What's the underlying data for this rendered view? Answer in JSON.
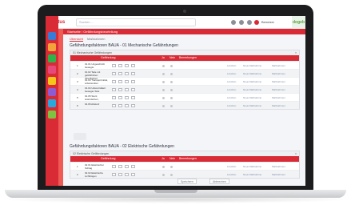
{
  "app": {
    "logo": "Meritus",
    "corner_logo": "dogeb",
    "search_placeholder": "Suchen ...",
    "user": "Benutzer"
  },
  "breadcrumb": "Startseite / Gefährdungsbeurteilung",
  "tabs": [
    {
      "label": "Übersicht",
      "active": true
    },
    {
      "label": "Maßnahmen",
      "active": false
    }
  ],
  "sections": [
    {
      "title": "Gefährdungsfaktoren BAUA - 01 Mechanische Gefährdungen",
      "panel_label": "01 Mechanische Gefährdungen",
      "columns": [
        "Gefährdung",
        "Ja",
        "Nein",
        "Bemerkungen"
      ],
      "rows": [
        {
          "num": "1",
          "text": "01.01 Ungeschützt bewegte Maschinenteile"
        },
        {
          "num": "2",
          "text": "01.02 Teile mit gefährlichen Oberflächen"
        },
        {
          "num": "3",
          "text": "01.03 Transportmittel, Arbeitsmittel"
        },
        {
          "num": "4",
          "text": "01.04 Unkontrolliert bewegte Teile"
        },
        {
          "num": "5",
          "text": "01.05 Sturz, Ausrutschen, Stolpern, Umknicken"
        },
        {
          "num": "6",
          "text": "01.06 Absturz"
        }
      ],
      "actions": [
        "Löschen",
        "Neue Maßnahme",
        "Maßnahmen"
      ]
    },
    {
      "title": "Gefährdungsfaktoren BAUA - 02 Elektrische Gefährdungen",
      "panel_label": "02 Elektrische Gefährdungen",
      "columns": [
        "Gefährdung",
        "Ja",
        "Nein",
        "Bemerkungen"
      ],
      "rows": [
        {
          "num": "1",
          "text": "02.01 Elektrischer Schlag"
        },
        {
          "num": "2",
          "text": "02.02 Elektrische Lichtbögen"
        }
      ],
      "actions": [
        "Löschen",
        "Neue Maßnahme",
        "Maßnahmen"
      ]
    }
  ],
  "footer": {
    "save": "Speichern",
    "cancel": "Abbrechen"
  },
  "colors": {
    "brand": "#d92b36",
    "nav_icon_colors": [
      "#3a7bd5",
      "#f2a33a",
      "#2db34a",
      "#e64a7c",
      "#f5c518",
      "#8e5bd0",
      "#29a8e0",
      "#7fc241"
    ]
  }
}
